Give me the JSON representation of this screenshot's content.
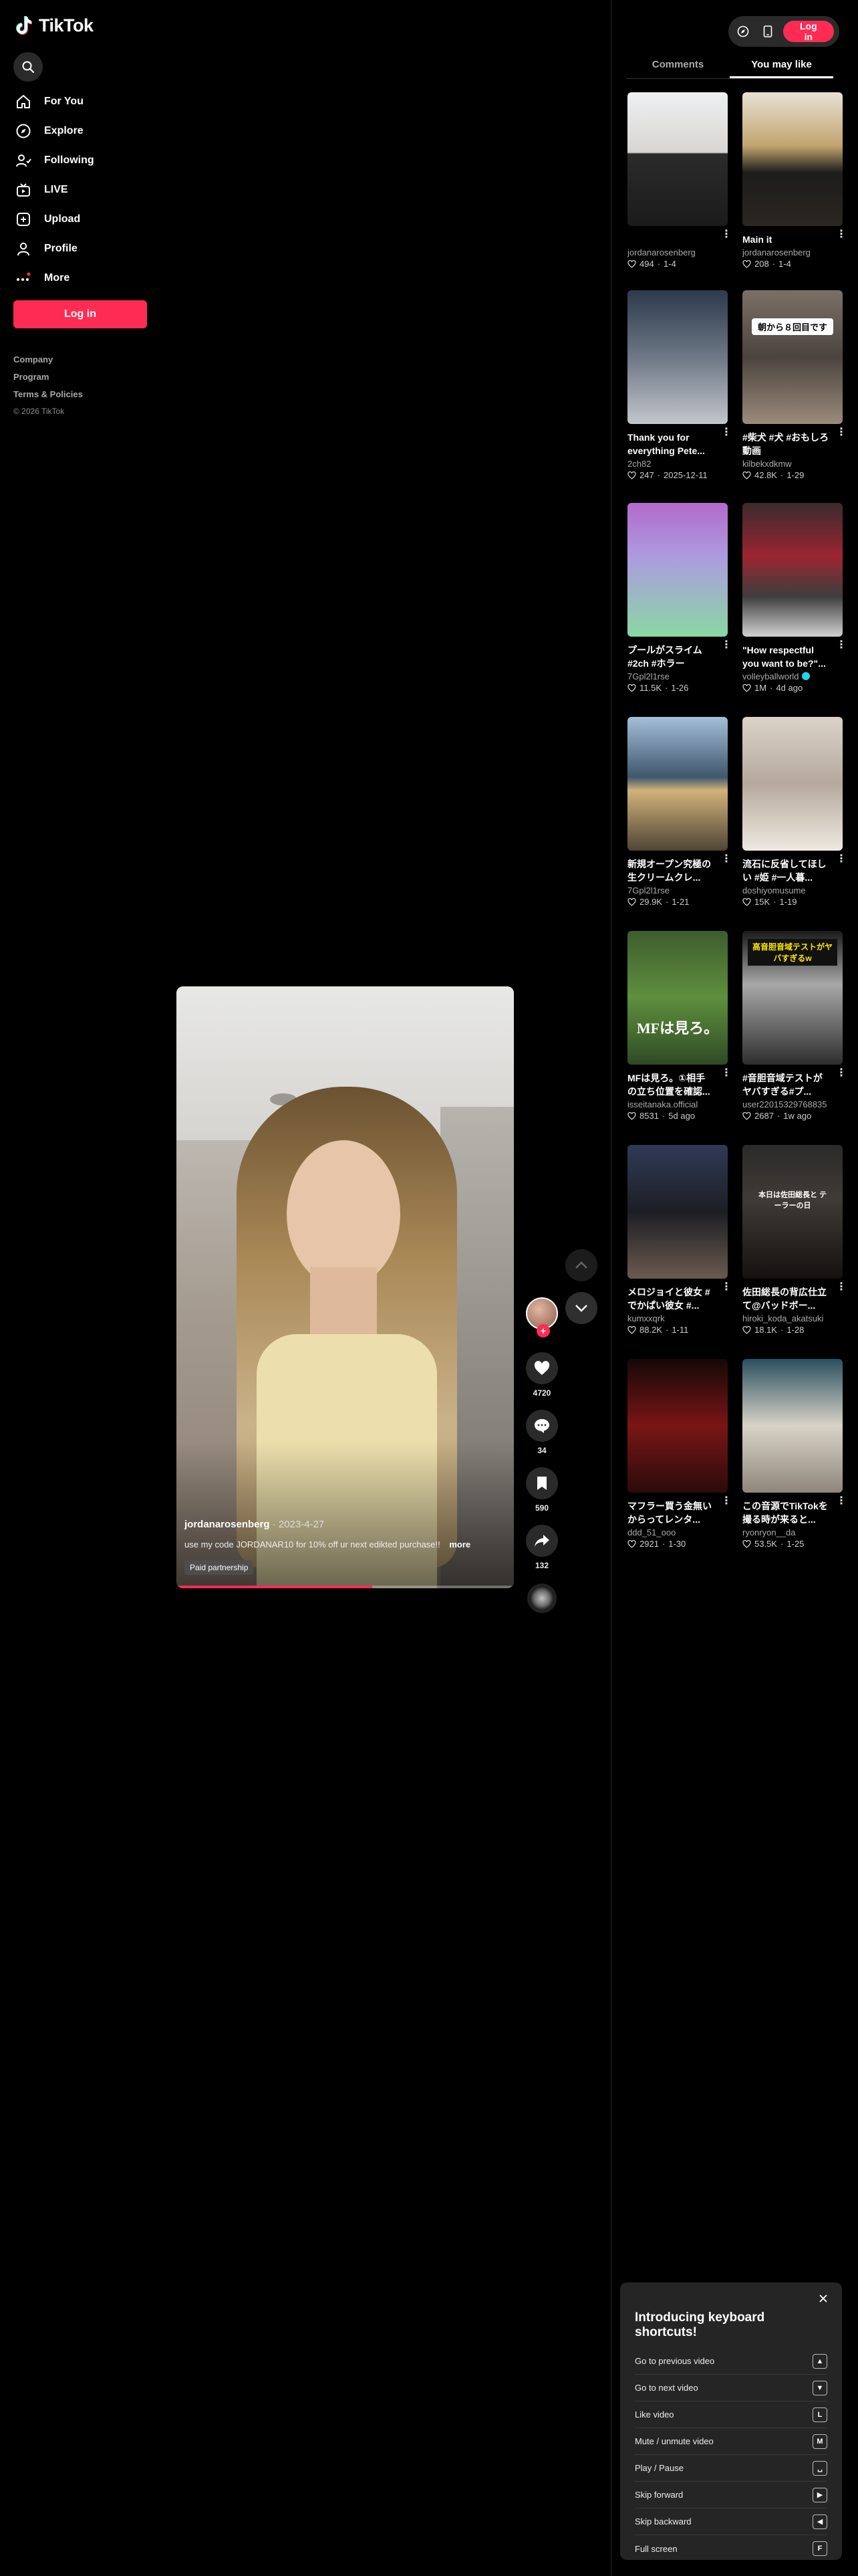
{
  "app": {
    "logo_text": "TikTok"
  },
  "sidebar": {
    "nav": [
      {
        "label": "For You",
        "icon": "home-icon"
      },
      {
        "label": "Explore",
        "icon": "compass-icon"
      },
      {
        "label": "Following",
        "icon": "following-icon"
      },
      {
        "label": "LIVE",
        "icon": "live-icon"
      },
      {
        "label": "Upload",
        "icon": "upload-icon"
      },
      {
        "label": "Profile",
        "icon": "profile-icon"
      },
      {
        "label": "More",
        "icon": "more-icon"
      }
    ],
    "login_label": "Log in",
    "footer": {
      "company": "Company",
      "program": "Program",
      "terms": "Terms & Policies",
      "copyright": "© 2026 TikTok"
    }
  },
  "topbar": {
    "login_label": "Log in"
  },
  "video": {
    "author": "jordanarosenberg",
    "date": "2023-4-27",
    "caption": "use my code JORDANAR10 for 10% off ur next edikted purchase!!",
    "more_label": "more",
    "tag": "Paid partnership",
    "progress": 0.58,
    "likes": "4720",
    "comments": "34",
    "saves": "590",
    "shares": "132"
  },
  "tabs": {
    "comments": "Comments",
    "you_may_like": "You may like",
    "active": "you_may_like"
  },
  "recommendations": [
    {
      "title": "",
      "author": "jordanarosenberg",
      "likes": "494",
      "date": "1-4",
      "verified": false,
      "overlay": ""
    },
    {
      "title": "Main it",
      "author": "jordanarosenberg",
      "likes": "208",
      "date": "1-4",
      "verified": false,
      "overlay": ""
    },
    {
      "title": "Thank you for everything Pete...",
      "author": "2ch82",
      "likes": "247",
      "date": "2025-12-11",
      "verified": false,
      "overlay": ""
    },
    {
      "title": "#柴犬 #犬 #おもしろ動画",
      "author": "kilbekxdkmw",
      "likes": "42.8K",
      "date": "1-29",
      "verified": false,
      "overlay": "朝から８回目です"
    },
    {
      "title": "プールがスライム #2ch #ホラー",
      "author": "7Gpl2l1rse",
      "likes": "11.5K",
      "date": "1-26",
      "verified": false,
      "overlay": ""
    },
    {
      "title": "\"How respectful you want to be?\"...",
      "author": "volleyballworld",
      "likes": "1M",
      "date": "4d ago",
      "verified": true,
      "overlay": ""
    },
    {
      "title": "新規オープン究極の生クリームクレ...",
      "author": "7Gpl2l1rse",
      "likes": "29.9K",
      "date": "1-21",
      "verified": false,
      "overlay": ""
    },
    {
      "title": "流石に反省してほしい #姫 #一人暮...",
      "author": "doshiyomusume",
      "likes": "15K",
      "date": "1-19",
      "verified": false,
      "overlay": ""
    },
    {
      "title": "MFは見ろ。①相手の立ち位置を確認...",
      "author": "isseitanaka.official",
      "likes": "8531",
      "date": "5d ago",
      "verified": false,
      "overlay": "MFは見ろ。"
    },
    {
      "title": "#音胆音域テストがヤバすぎる#プ...",
      "author": "user22015329768835",
      "likes": "2687",
      "date": "1w ago",
      "verified": false,
      "overlay": "高音胆音域テストがヤバすぎるw"
    },
    {
      "title": "メロジョイと彼女 #でかぱい彼女 #...",
      "author": "kumxxqrk",
      "likes": "88.2K",
      "date": "1-11",
      "verified": false,
      "overlay": ""
    },
    {
      "title": "佐田総長の背広仕立て@バッドボー...",
      "author": "hiroki_koda_akatsuki",
      "likes": "18.1K",
      "date": "1-28",
      "verified": false,
      "overlay": "本日は佐田総長と テーラーの日"
    },
    {
      "title": "マフラー買う金無いからってレンタ...",
      "author": "ddd_51_ooo",
      "likes": "2921",
      "date": "1-30",
      "verified": false,
      "overlay": ""
    },
    {
      "title": "この音源でTikTokを撮る時が来ると...",
      "author": "ryonryon__da",
      "likes": "53.5K",
      "date": "1-25",
      "verified": false,
      "overlay": ""
    }
  ],
  "shortcuts": {
    "title": "Introducing keyboard shortcuts!",
    "items": [
      {
        "label": "Go to previous video",
        "key": "▲"
      },
      {
        "label": "Go to next video",
        "key": "▼"
      },
      {
        "label": "Like video",
        "key": "L"
      },
      {
        "label": "Mute / unmute video",
        "key": "M"
      },
      {
        "label": "Play / Pause",
        "key": "␣"
      },
      {
        "label": "Skip forward",
        "key": "▶"
      },
      {
        "label": "Skip backward",
        "key": "◀"
      },
      {
        "label": "Full screen",
        "key": "F"
      }
    ]
  }
}
